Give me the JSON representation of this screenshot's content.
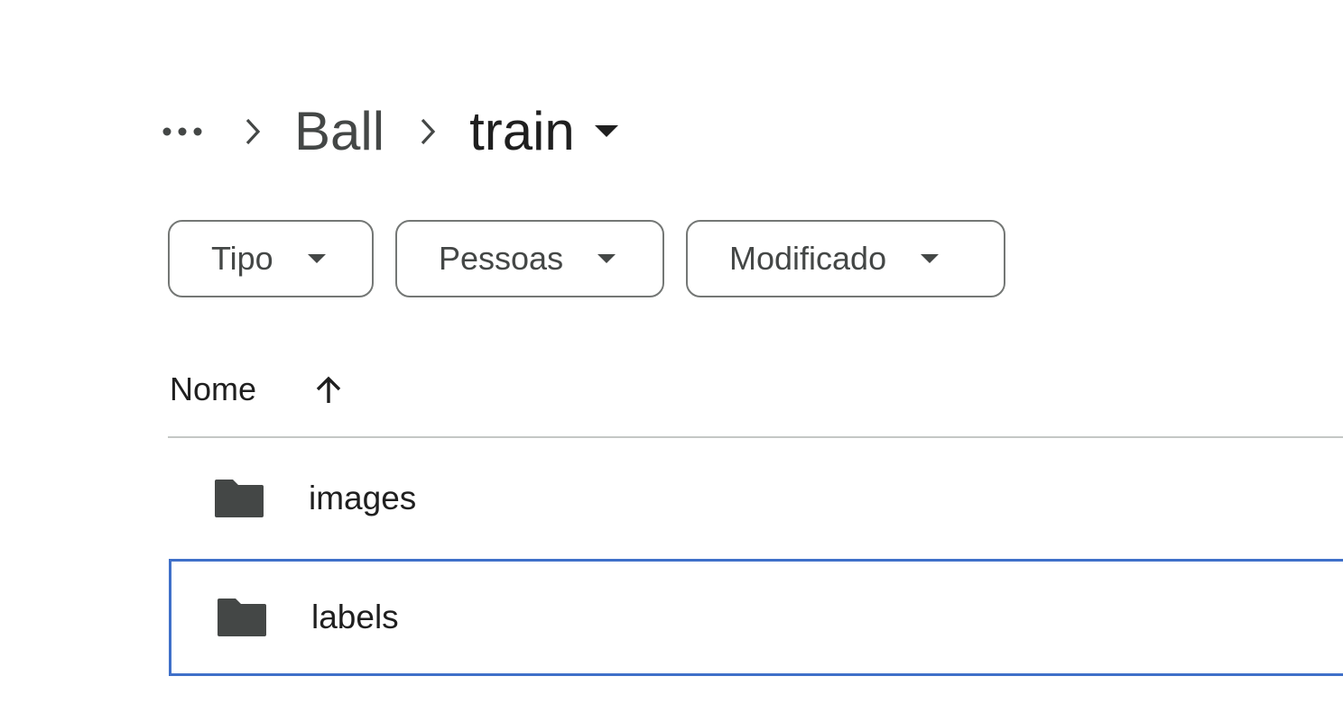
{
  "breadcrumb": {
    "more_icon": "more-horiz-icon",
    "separator_icon": "chevron-right-icon",
    "parent_label": "Ball",
    "current_label": "train",
    "current_caret_icon": "arrow-drop-down-icon"
  },
  "filters": [
    {
      "label": "Tipo",
      "icon": "arrow-drop-down-icon"
    },
    {
      "label": "Pessoas",
      "icon": "arrow-drop-down-icon"
    },
    {
      "label": "Modificado",
      "icon": "arrow-drop-down-icon"
    }
  ],
  "table": {
    "column_name": "Nome",
    "sort_icon": "arrow-upward-icon",
    "rows": [
      {
        "name": "images",
        "icon": "folder-icon",
        "selected": false
      },
      {
        "name": "labels",
        "icon": "folder-icon",
        "selected": true
      }
    ]
  },
  "colors": {
    "text_primary": "#1f1f1f",
    "text_secondary": "#444746",
    "chip_border": "#747775",
    "divider": "#c4c7c5",
    "selection_border": "#3f70c9",
    "icon_dark": "#444746"
  }
}
